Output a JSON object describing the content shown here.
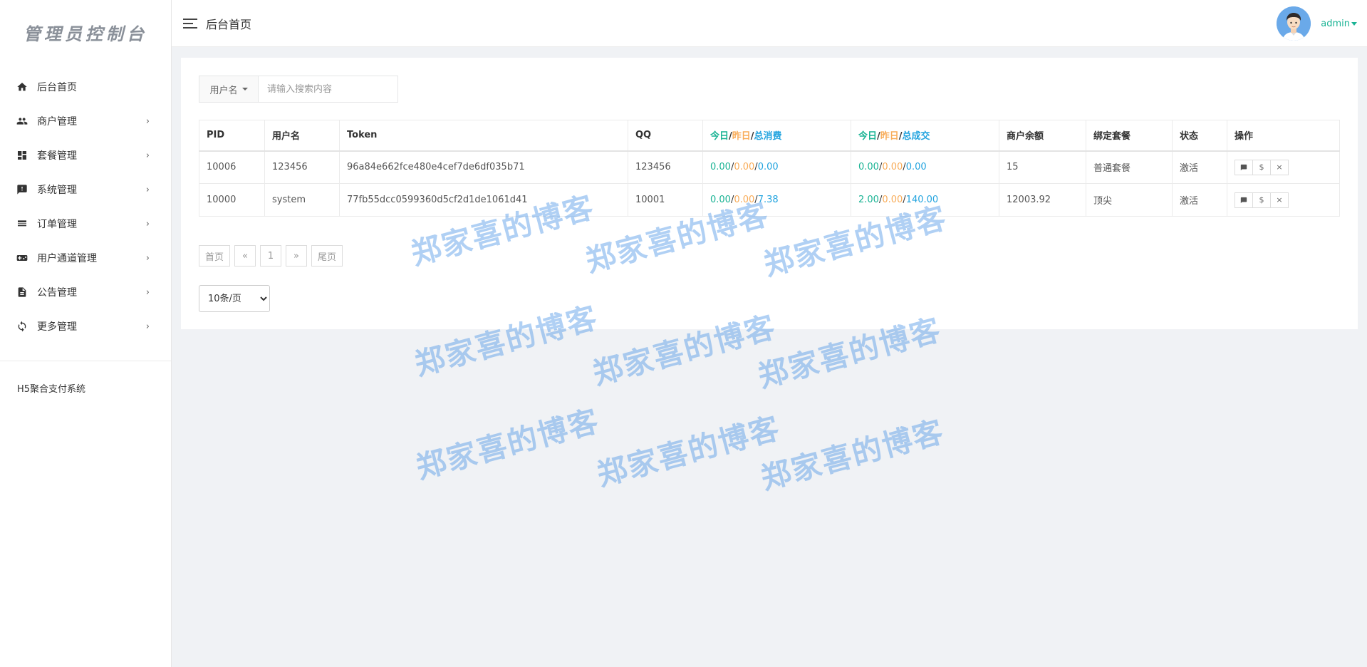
{
  "sidebar": {
    "logo": "管理员控制台",
    "items": [
      {
        "label": "后台首页",
        "icon": "home-icon",
        "expandable": false
      },
      {
        "label": "商户管理",
        "icon": "users-icon",
        "expandable": true
      },
      {
        "label": "套餐管理",
        "icon": "dashboard-icon",
        "expandable": true
      },
      {
        "label": "系统管理",
        "icon": "feedback-icon",
        "expandable": true
      },
      {
        "label": "订单管理",
        "icon": "list-icon",
        "expandable": true
      },
      {
        "label": "用户通道管理",
        "icon": "gamepad-icon",
        "expandable": true
      },
      {
        "label": "公告管理",
        "icon": "document-icon",
        "expandable": true
      },
      {
        "label": "更多管理",
        "icon": "refresh-icon",
        "expandable": true
      }
    ],
    "chevron": "›",
    "footer": "H5聚合支付系统"
  },
  "header": {
    "title": "后台首页",
    "user": "admin"
  },
  "search": {
    "field_label": "用户名",
    "placeholder": "请输入搜索内容"
  },
  "table": {
    "headers": {
      "pid": "PID",
      "username": "用户名",
      "token": "Token",
      "qq": "QQ",
      "consume": {
        "today": "今日",
        "yesterday": "昨日",
        "total": "总消费"
      },
      "trade": {
        "today": "今日",
        "yesterday": "昨日",
        "total": "总成交"
      },
      "balance": "商户余额",
      "plan": "绑定套餐",
      "status": "状态",
      "actions": "操作"
    },
    "rows": [
      {
        "pid": "10006",
        "username": "123456",
        "token": "96a84e662fce480e4cef7de6df035b71",
        "qq": "123456",
        "consume": {
          "today": "0.00",
          "yesterday": "0.00",
          "total": "0.00"
        },
        "trade": {
          "today": "0.00",
          "yesterday": "0.00",
          "total": "0.00"
        },
        "balance": "15",
        "plan": "普通套餐",
        "status": "激活"
      },
      {
        "pid": "10000",
        "username": "system",
        "token": "77fb55dcc0599360d5cf2d1de1061d41",
        "qq": "10001",
        "consume": {
          "today": "0.00",
          "yesterday": "0.00",
          "total": "7.38"
        },
        "trade": {
          "today": "2.00",
          "yesterday": "0.00",
          "total": "140.00"
        },
        "balance": "12003.92",
        "plan": "顶尖",
        "status": "激活"
      }
    ],
    "action_labels": {
      "message": "",
      "money": "$",
      "delete": "×"
    },
    "slash": "/"
  },
  "pagination": {
    "first": "首页",
    "prev": "«",
    "current": "1",
    "next": "»",
    "last": "尾页"
  },
  "page_size": {
    "selected": "10条/页"
  },
  "watermark": "郑家喜的博客",
  "colors": {
    "green": "#1ab394",
    "orange": "#f8ac59",
    "blue": "#23a4df"
  }
}
